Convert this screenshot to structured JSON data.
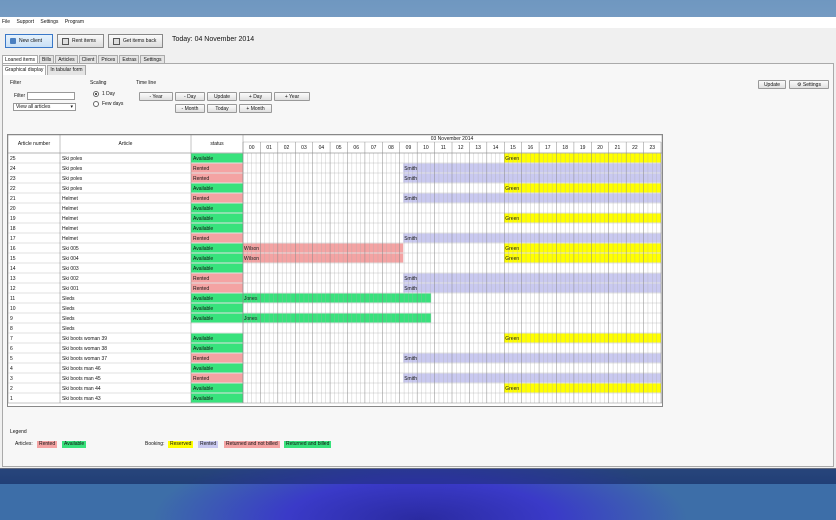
{
  "menu": [
    "File",
    "Support",
    "Settings",
    "Program"
  ],
  "toolbar": {
    "new_client": "New client",
    "rent_items": "Rent items",
    "get_items_back": "Get items back",
    "today": "Today: 04 November 2014"
  },
  "tabs": [
    "Loaned items",
    "Bills",
    "Articles",
    "Client",
    "Prices",
    "Extras",
    "Settings"
  ],
  "subtabs": [
    "Graphical display",
    "In tabular form"
  ],
  "filter": {
    "group": "Filter",
    "label": "Filter",
    "value": "",
    "select": "View all articles"
  },
  "scaling": {
    "group": "Scaling",
    "options": [
      "1 Day",
      "Few days"
    ],
    "selected": "1 Day"
  },
  "timeline": {
    "group": "Time line",
    "buttons": [
      "- Year",
      "- Day",
      "Update",
      "+ Day",
      "+ Year",
      "- Month",
      "Today",
      "+ Month"
    ]
  },
  "right_buttons": {
    "update": "Update",
    "settings": "Settings"
  },
  "table": {
    "col_article_number": "Article number",
    "col_article": "Article",
    "col_status": "status",
    "date": "03 November 2014",
    "hours": [
      "00",
      "01",
      "02",
      "03",
      "04",
      "05",
      "06",
      "07",
      "08",
      "09",
      "10",
      "11",
      "12",
      "13",
      "14",
      "15",
      "16",
      "17",
      "18",
      "19",
      "20",
      "21",
      "22",
      "23"
    ],
    "rows": [
      {
        "num": "25",
        "article": "Ski poles",
        "status": "Available",
        "booking": {
          "name": "Green",
          "start": 15,
          "end": 24,
          "type": "reserved"
        }
      },
      {
        "num": "24",
        "article": "Ski poles",
        "status": "Rented",
        "booking": {
          "name": "Smith",
          "start": 9.2,
          "end": 24,
          "type": "rented"
        }
      },
      {
        "num": "23",
        "article": "Ski poles",
        "status": "Rented",
        "booking": {
          "name": "Smith",
          "start": 9.2,
          "end": 24,
          "type": "rented"
        }
      },
      {
        "num": "22",
        "article": "Ski poles",
        "status": "Available",
        "booking": {
          "name": "Green",
          "start": 15,
          "end": 24,
          "type": "reserved"
        }
      },
      {
        "num": "21",
        "article": "Helmet",
        "status": "Rented",
        "booking": {
          "name": "Smith",
          "start": 9.2,
          "end": 24,
          "type": "rented"
        }
      },
      {
        "num": "20",
        "article": "Helmet",
        "status": "Available",
        "booking": null
      },
      {
        "num": "19",
        "article": "Helmet",
        "status": "Available",
        "booking": {
          "name": "Green",
          "start": 15,
          "end": 24,
          "type": "reserved"
        }
      },
      {
        "num": "18",
        "article": "Helmet",
        "status": "Available",
        "booking": null
      },
      {
        "num": "17",
        "article": "Helmet",
        "status": "Rented",
        "booking": {
          "name": "Smith",
          "start": 9.2,
          "end": 24,
          "type": "rented"
        }
      },
      {
        "num": "16",
        "article": "Ski 005",
        "status": "Available",
        "booking": [
          {
            "name": "Wilson",
            "start": 0,
            "end": 9.2,
            "type": "returned_not_billed"
          },
          {
            "name": "Green",
            "start": 15,
            "end": 24,
            "type": "reserved"
          }
        ]
      },
      {
        "num": "15",
        "article": "Ski 004",
        "status": "Available",
        "booking": [
          {
            "name": "Wilson",
            "start": 0,
            "end": 9.2,
            "type": "returned_not_billed"
          },
          {
            "name": "Green",
            "start": 15,
            "end": 24,
            "type": "reserved"
          }
        ]
      },
      {
        "num": "14",
        "article": "Ski 003",
        "status": "Available",
        "booking": null
      },
      {
        "num": "13",
        "article": "Ski 002",
        "status": "Rented",
        "booking": {
          "name": "Smith",
          "start": 9.2,
          "end": 24,
          "type": "rented"
        }
      },
      {
        "num": "12",
        "article": "Ski 001",
        "status": "Rented",
        "booking": {
          "name": "Smith",
          "start": 9.2,
          "end": 24,
          "type": "rented"
        }
      },
      {
        "num": "11",
        "article": "Sleds",
        "status": "Available",
        "booking": {
          "name": "Jones",
          "start": 0,
          "end": 10.8,
          "type": "returned_billed"
        }
      },
      {
        "num": "10",
        "article": "Sleds",
        "status": "Available",
        "booking": null
      },
      {
        "num": "9",
        "article": "Sleds",
        "status": "Available",
        "booking": {
          "name": "Jones",
          "start": 0,
          "end": 10.8,
          "type": "returned_billed"
        }
      },
      {
        "num": "8",
        "article": "Sleds",
        "status": "",
        "booking": null
      },
      {
        "num": "7",
        "article": "Ski boots woman 39",
        "status": "Available",
        "booking": {
          "name": "Green",
          "start": 15,
          "end": 24,
          "type": "reserved"
        }
      },
      {
        "num": "6",
        "article": "Ski boots woman 38",
        "status": "Available",
        "booking": null
      },
      {
        "num": "5",
        "article": "Ski boots woman 37",
        "status": "Rented",
        "booking": {
          "name": "Smith",
          "start": 9.2,
          "end": 24,
          "type": "rented"
        }
      },
      {
        "num": "4",
        "article": "Ski boots man 46",
        "status": "Available",
        "booking": null
      },
      {
        "num": "3",
        "article": "Ski boots man 45",
        "status": "Rented",
        "booking": {
          "name": "Smith",
          "start": 9.2,
          "end": 24,
          "type": "rented"
        }
      },
      {
        "num": "2",
        "article": "Ski boots man 44",
        "status": "Available",
        "booking": {
          "name": "Green",
          "start": 15,
          "end": 24,
          "type": "reserved"
        }
      },
      {
        "num": "1",
        "article": "Ski boots man 43",
        "status": "Available",
        "booking": null
      }
    ]
  },
  "legend": {
    "title": "Legend",
    "articles_label": "Articles:",
    "articles": [
      {
        "label": "Rented",
        "color": "#f4a3a3"
      },
      {
        "label": "Available",
        "color": "#38e27c"
      }
    ],
    "booking_label": "Booking:",
    "booking": [
      {
        "label": "Reserved",
        "color": "#ffff00"
      },
      {
        "label": "Rented",
        "color": "#c9c9f0"
      },
      {
        "label": "Returned and not billed",
        "color": "#f4a3a3"
      },
      {
        "label": "Returned and billed",
        "color": "#38e27c"
      }
    ]
  },
  "colors": {
    "rented": "#c9c9f0",
    "reserved": "#ffff00",
    "returned_not_billed": "#f4a3a3",
    "returned_billed": "#38e27c",
    "status_available": "#38e27c",
    "status_rented": "#f4a3a3"
  }
}
